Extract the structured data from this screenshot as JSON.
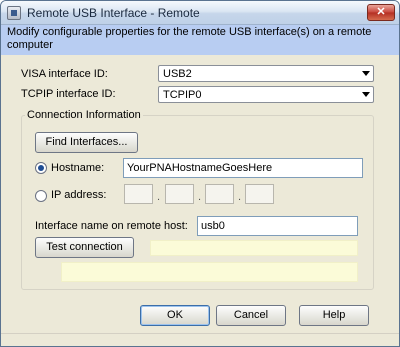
{
  "window": {
    "title": "Remote USB Interface - Remote",
    "close_glyph": "✕",
    "description": "Modify configurable properties for the remote USB interface(s) on a remote computer"
  },
  "form": {
    "visa_label": "VISA interface ID:",
    "visa_value": "USB2",
    "tcpip_label": "TCPIP interface ID:",
    "tcpip_value": "TCPIP0"
  },
  "connection": {
    "group_title": "Connection Information",
    "find_button": "Find Interfaces...",
    "hostname_label": "Hostname:",
    "hostname_value": "YourPNAHostnameGoesHere",
    "hostname_selected": true,
    "ip_label": "IP address:",
    "ip_separator": ".",
    "remote_name_label": "Interface name on remote host:",
    "remote_name_value": "usb0",
    "test_button": "Test connection"
  },
  "footer": {
    "ok": "OK",
    "cancel": "Cancel",
    "help": "Help"
  },
  "colors": {
    "banner": "#b8cdf2",
    "status_bg": "#fbfbd8",
    "window_bg": "#ece9d8"
  }
}
